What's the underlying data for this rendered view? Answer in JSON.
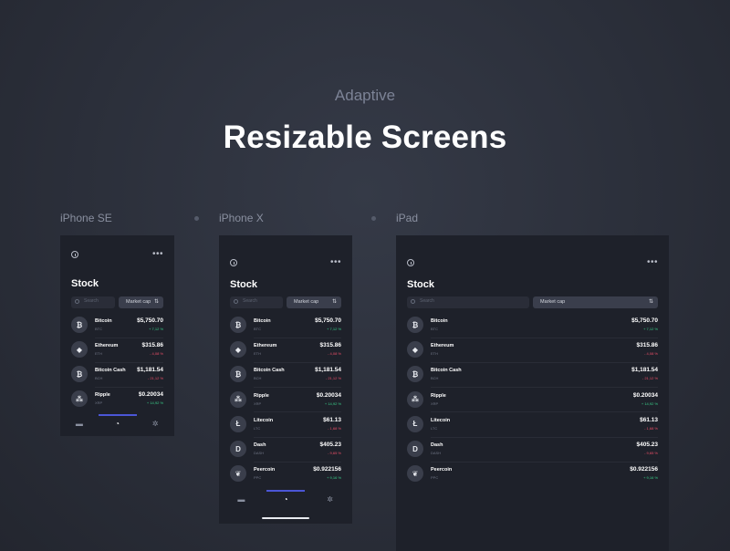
{
  "header": {
    "subtitle": "Adaptive",
    "title": "Resizable Screens"
  },
  "devices": [
    {
      "label": "iPhone SE"
    },
    {
      "label": "iPhone X"
    },
    {
      "label": "iPad"
    }
  ],
  "app": {
    "title": "Stock",
    "search_placeholder": "Search",
    "sort_label": "Market cap",
    "sort_icon": "⇅",
    "more_icon": "•••",
    "coins": [
      {
        "name": "Bitcoin",
        "symbol": "BTC",
        "price": "$5,750.70",
        "change": "+ 7,12 %",
        "direction": "up",
        "glyph": "₿"
      },
      {
        "name": "Ethereum",
        "symbol": "ETH",
        "price": "$315.86",
        "change": "- 4,08 %",
        "direction": "down",
        "glyph": "◆"
      },
      {
        "name": "Bitcoin Cash",
        "symbol": "BCH",
        "price": "$1,181.54",
        "change": "- 21,12 %",
        "direction": "down",
        "glyph": "₿"
      },
      {
        "name": "Ripple",
        "symbol": "XRP",
        "price": "$0.20034",
        "change": "+ 14,92 %",
        "direction": "up",
        "glyph": "⁂"
      },
      {
        "name": "Litecoin",
        "symbol": "LTC",
        "price": "$61.13",
        "change": "- 1,68 %",
        "direction": "down",
        "glyph": "Ł"
      },
      {
        "name": "Dash",
        "symbol": "DASH",
        "price": "$405.23",
        "change": "- 9,65 %",
        "direction": "down",
        "glyph": "D"
      },
      {
        "name": "Peercoin",
        "symbol": "PPC",
        "price": "$0.922156",
        "change": "+ 9,16 %",
        "direction": "up",
        "glyph": "❦"
      }
    ],
    "tabs": [
      {
        "name": "wallet",
        "glyph": "▬"
      },
      {
        "name": "portfolio",
        "glyph": "◔"
      },
      {
        "name": "settings",
        "glyph": "✲"
      }
    ]
  },
  "colors": {
    "up": "#3ad08a",
    "down": "#f0506a",
    "accent": "#4b56d6",
    "screen_bg": "#1e212a"
  }
}
